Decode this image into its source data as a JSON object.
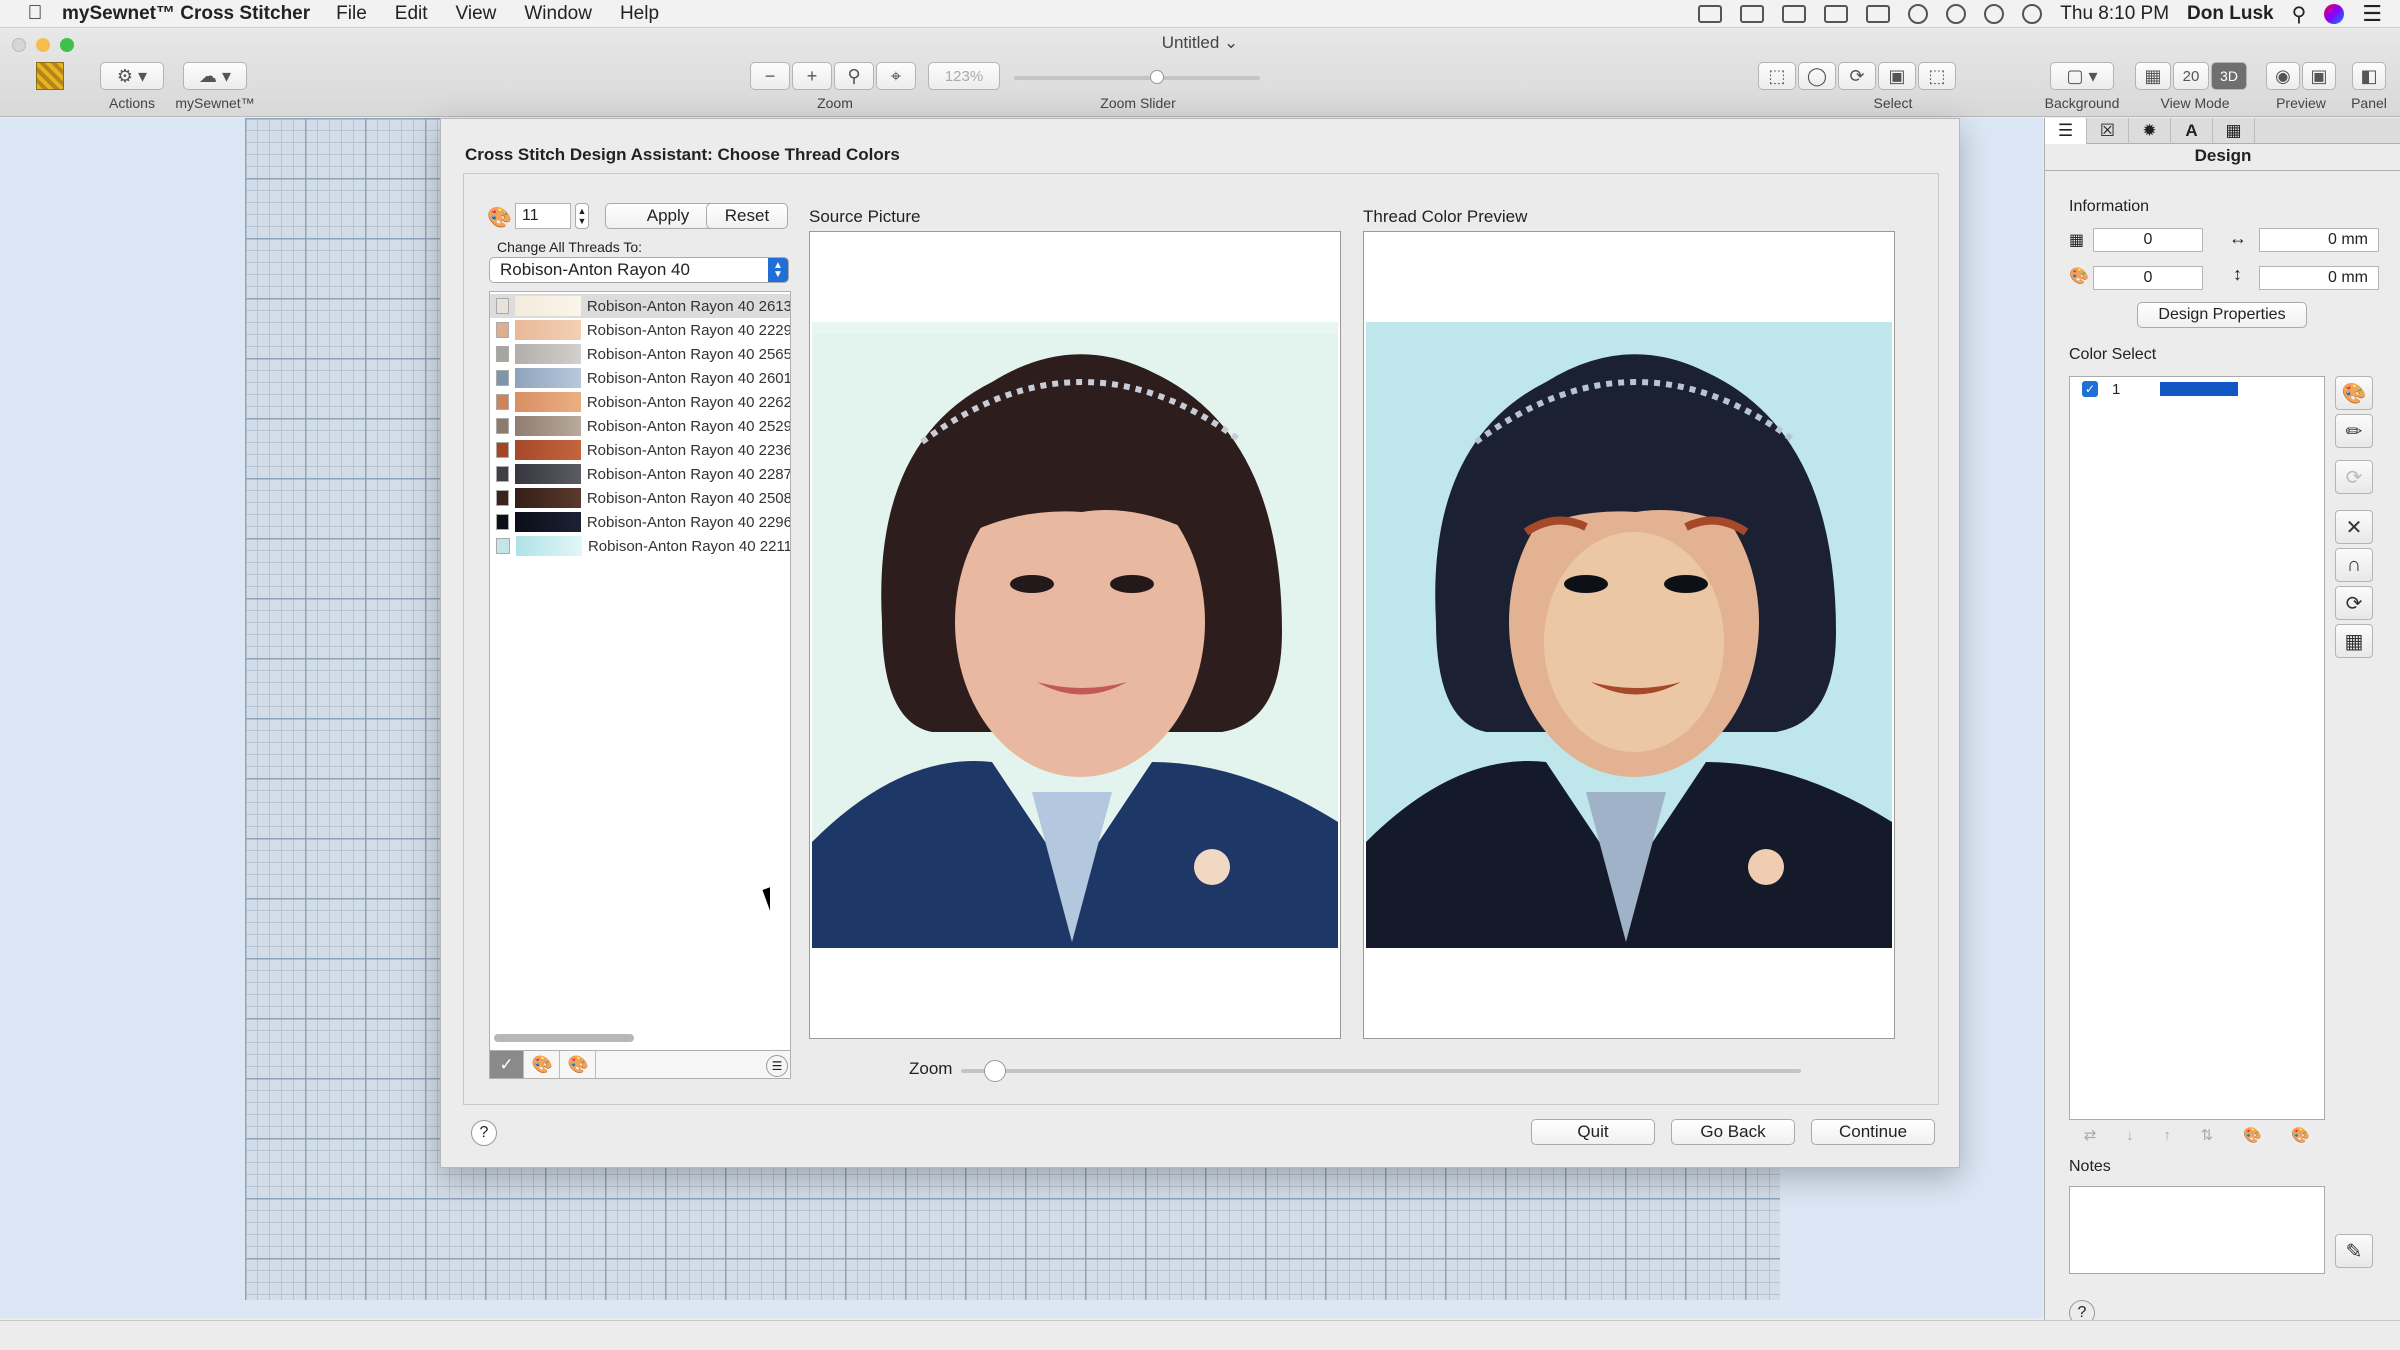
{
  "menubar": {
    "app_name": "mySewnet™ Cross Stitcher",
    "menus": [
      "File",
      "Edit",
      "View",
      "Window",
      "Help"
    ],
    "clock": "Thu 8:10 PM",
    "user": "Don Lusk"
  },
  "window": {
    "title": "Untitled ⌄"
  },
  "toolbar": {
    "actions_label": "Actions",
    "mysewnet_label": "mySewnet™",
    "zoom_label": "Zoom",
    "zoom_value": "123%",
    "zoom_slider_label": "Zoom Slider",
    "zoom_slider_level": 0.58,
    "select_label": "Select",
    "background_label": "Background",
    "view_mode_label": "View Mode",
    "view_mode_number": "20",
    "view_mode_3d": "3D",
    "preview_label": "Preview",
    "panel_label": "Panel"
  },
  "dialog": {
    "title": "Cross Stitch Design Assistant: Choose Thread Colors",
    "color_count": "11",
    "apply_label": "Apply",
    "reset_label": "Reset",
    "change_all_label": "Change All Threads To:",
    "thread_brand": "Robison-Anton Rayon 40",
    "threads": [
      {
        "label": "Robison-Anton Rayon 40 2613",
        "chip": "#e8e2da",
        "from": "#f3ebdc",
        "to": "#fbf4e8"
      },
      {
        "label": "Robison-Anton Rayon 40 2229",
        "chip": "#dfae8e",
        "from": "#e7b998",
        "to": "#f3d0b4"
      },
      {
        "label": "Robison-Anton Rayon 40 2565",
        "chip": "#a8a5a1",
        "from": "#b3aeaa",
        "to": "#d2cfcc"
      },
      {
        "label": "Robison-Anton Rayon 40 2601",
        "chip": "#7f95ab",
        "from": "#8ea3bb",
        "to": "#b9c9dc"
      },
      {
        "label": "Robison-Anton Rayon 40 2262",
        "chip": "#cf8358",
        "from": "#d98f63",
        "to": "#ebaf84"
      },
      {
        "label": "Robison-Anton Rayon 40 2529",
        "chip": "#8f7a6b",
        "from": "#8f7d70",
        "to": "#b8aa9c"
      },
      {
        "label": "Robison-Anton Rayon 40 2236",
        "chip": "#a54525",
        "from": "#a5492a",
        "to": "#c4653c"
      },
      {
        "label": "Robison-Anton Rayon 40 2287",
        "chip": "#3f3f45",
        "from": "#37383f",
        "to": "#5a5b63"
      },
      {
        "label": "Robison-Anton Rayon 40 2508",
        "chip": "#3b241c",
        "from": "#341f18",
        "to": "#5a3a2c"
      },
      {
        "label": "Robison-Anton Rayon 40 2296",
        "chip": "#0c0f18",
        "from": "#0a0e18",
        "to": "#1c2235"
      },
      {
        "label": "Robison-Anton Rayon 40 2211",
        "chip": "#c2e6e8",
        "from": "#aee3e8",
        "to": "#e3f6f7"
      }
    ],
    "source_label": "Source Picture",
    "preview_label": "Thread Color Preview",
    "zoom_label": "Zoom",
    "zoom_level": 0.04,
    "quit_label": "Quit",
    "go_back_label": "Go Back",
    "continue_label": "Continue",
    "help_label": "?"
  },
  "right_panel": {
    "tab_label": "Design",
    "tab_icons": [
      "list-icon",
      "stitch-icon",
      "dots-icon",
      "text-icon",
      "pattern-icon"
    ],
    "text_tab_glyph": "A",
    "information_label": "Information",
    "stitch_count": "0",
    "width": "0 mm",
    "color_count": "0",
    "height": "0 mm",
    "design_properties_label": "Design Properties",
    "color_select_label": "Color Select",
    "colors": [
      {
        "number": "1",
        "swatch": "#1057c4",
        "checked": true
      }
    ],
    "notes_label": "Notes",
    "help_label": "?"
  }
}
